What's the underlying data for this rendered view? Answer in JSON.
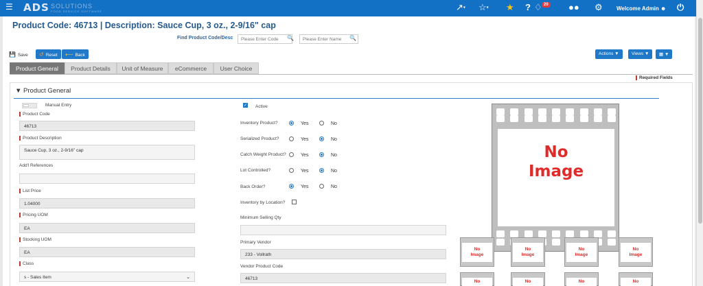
{
  "topbar": {
    "menu_icon": "hamburger-icon",
    "logo_text": "ADS",
    "logo_sub": "SOLUTIONS",
    "logo_tag": "FOOD SERVICE SOFTWARE",
    "notification_count": "20",
    "welcome": "Welcome Admin",
    "color": "#1271c4"
  },
  "header": {
    "title": "Product Code:  46713 | Description: Sauce Cup, 3 oz., 2-9/16\" cap",
    "find_label": "Find Product Code/Desc",
    "code_placeholder": "Please Enter Code",
    "name_placeholder": "Please Enter Name"
  },
  "toolbar": {
    "save": "Save",
    "reset": "Reset",
    "back": "Back",
    "actions": "Actions",
    "views": "Views"
  },
  "tabs": [
    "Product General",
    "Product Details",
    "Unit of Measure",
    "eCommerce",
    "User Choice"
  ],
  "required_fields": "Required Fields",
  "section": {
    "title": "Product General"
  },
  "left": {
    "manual_entry": "Manual Entry",
    "product_code_label": "Product Code",
    "product_code": "46713",
    "product_desc_label": "Product Description",
    "product_desc": "Sauce Cup, 3 oz., 2-9/16\" cap",
    "addl_refs_label": "Add'l References",
    "addl_refs": "",
    "list_price_label": "List Price",
    "list_price": "1.04000",
    "pricing_uom_label": "Pricing UOM",
    "pricing_uom": "EA",
    "stocking_uom_label": "Stocking UOM",
    "stocking_uom": "EA",
    "class_label": "Class",
    "class_value": "s - Sales Item"
  },
  "middle": {
    "active": "Active",
    "yes": "Yes",
    "no": "No",
    "inventory_product": "Inventory Product?",
    "serialized_product": "Serialized Product?",
    "catch_weight": "Catch Weight Product?",
    "lot_controlled": "Lot Controlled?",
    "back_order": "Back Order?",
    "inventory_by_location": "Inventory by Location?",
    "min_selling_qty_label": "Minimum Selling Qty",
    "min_selling_qty": "",
    "primary_vendor_label": "Primary Vendor",
    "primary_vendor": "233 - Vollrath",
    "vendor_product_code_label": "Vendor Product Code",
    "vendor_product_code": "46713",
    "radios": {
      "inventory_product": "yes",
      "serialized_product": "no",
      "catch_weight": "no",
      "lot_controlled": "no",
      "back_order": "yes"
    },
    "inventory_by_location_checked": false,
    "active_checked": true
  },
  "images": {
    "big_line1": "No",
    "big_line2": "Image",
    "small_line1": "No",
    "small_line2": "Image"
  }
}
